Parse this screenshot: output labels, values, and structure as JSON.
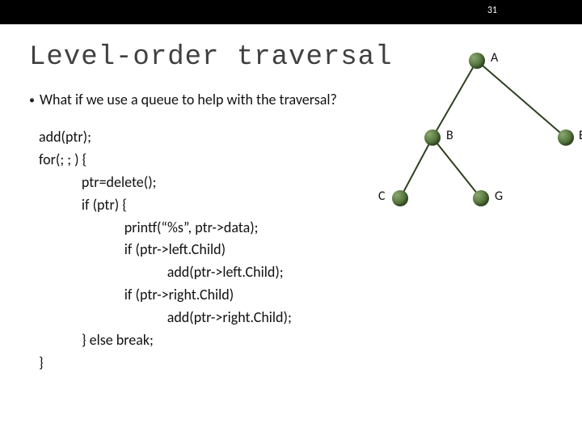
{
  "page_number": "31",
  "title": "Level-order traversal",
  "bullet": "What if we use a queue to help with the traversal?",
  "code": {
    "l1": "add(ptr);",
    "l2": "for(; ; ) {",
    "l3": "             ptr=delete();",
    "l4": "             if (ptr) {",
    "l5": "                          printf(“%s”, ptr->data);",
    "l6": "                          if (ptr->left.Child)",
    "l7": "                                       add(ptr->left.Child);",
    "l8": "                          if (ptr->right.Child)",
    "l9": "                                       add(ptr->right.Child);",
    "l10": "             } else break;",
    "l11": "}"
  },
  "tree": {
    "A": "A",
    "B": "B",
    "C": "C",
    "E": "E",
    "G": "G"
  }
}
